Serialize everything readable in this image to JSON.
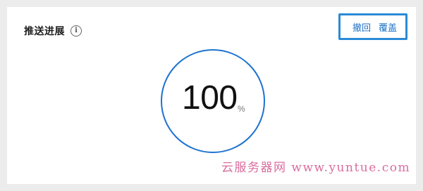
{
  "panel": {
    "title": "推送进展",
    "info_icon": "info-circle-icon"
  },
  "actions": {
    "revoke_label": "撤回",
    "overwrite_label": "覆盖"
  },
  "progress": {
    "value": "100",
    "unit": "%"
  },
  "watermark": {
    "text": "云服务器网 www.yuntue.com"
  },
  "colors": {
    "accent": "#1d72d0",
    "link": "#1a6fc7",
    "highlight_border": "#2b8ad6",
    "watermark": "#d96d9e"
  }
}
